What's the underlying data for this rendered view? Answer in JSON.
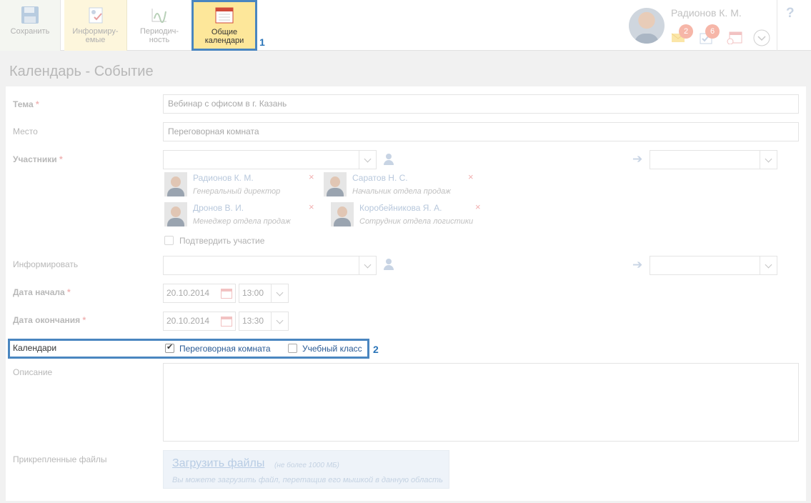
{
  "toolbar": {
    "save": "Сохранить",
    "inform_line1": "Информиру-",
    "inform_line2": "емые",
    "period_line1": "Периодич-",
    "period_line2": "ность",
    "calendars_line1": "Общие",
    "calendars_line2": "календари",
    "marker1": "1"
  },
  "user": {
    "name": "Радионов К. М.",
    "mail_count": "2",
    "tasks_count": "6"
  },
  "help": "?",
  "page_title": "Календарь - Событие",
  "form": {
    "subject_label": "Тема",
    "subject_value": "Вебинар с офисом в г. Казань",
    "place_label": "Место",
    "place_value": "Переговорная комната",
    "participants_label": "Участники",
    "required_mark": "*",
    "participants": [
      {
        "name": "Радионов К. М.",
        "role": "Генеральный директор"
      },
      {
        "name": "Саратов Н. С.",
        "role": "Начальник отдела продаж"
      },
      {
        "name": "Дронов В. И.",
        "role": "Менеджер отдела продаж"
      },
      {
        "name": "Коробейникова Я. А.",
        "role": "Сотрудник отдела логистики"
      }
    ],
    "remove_mark": "×",
    "confirm_label": "Подтвердить участие",
    "inform_label": "Информировать",
    "start_label": "Дата начала",
    "start_date": "20.10.2014",
    "start_time": "13:00",
    "end_label": "Дата окончания",
    "end_date": "20.10.2014",
    "end_time": "13:30",
    "calendars_label": "Календари",
    "calendar_options": [
      {
        "label": "Переговорная комната",
        "checked": true
      },
      {
        "label": "Учебный класс",
        "checked": false
      }
    ],
    "marker2": "2",
    "description_label": "Описание",
    "files_label": "Прикрепленные файлы",
    "upload_link": "Загрузить файлы",
    "upload_limit": "(не более 1000 МБ)",
    "upload_hint": "Вы можете загрузить файл, перетащив его мышкой в данную область"
  },
  "colors": {
    "highlight_border": "#4a86c0",
    "active_tab": "#fde79a",
    "badge": "#f6b6a8"
  }
}
